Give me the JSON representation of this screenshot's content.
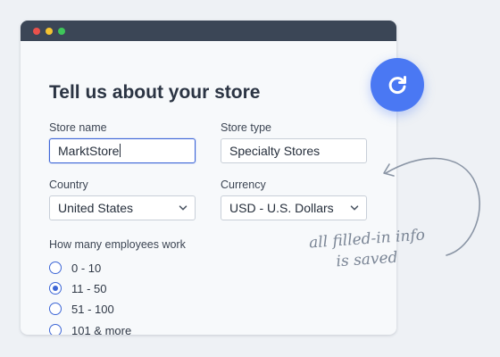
{
  "window": {
    "traffic_lights": [
      "#e9514b",
      "#f3c332",
      "#3ec65a"
    ]
  },
  "form": {
    "title": "Tell us about your store",
    "store_name": {
      "label": "Store name",
      "value": "MarktStore"
    },
    "store_type": {
      "label": "Store type",
      "value": "Specialty Stores"
    },
    "country": {
      "label": "Country",
      "value": "United States"
    },
    "currency": {
      "label": "Currency",
      "value": "USD - U.S. Dollars"
    },
    "employees": {
      "label": "How many employees work",
      "options": [
        "0 - 10",
        "11 - 50",
        "51 - 100",
        "101 & more"
      ],
      "selected": "11 - 50"
    }
  },
  "refresh_button": {
    "icon": "refresh-icon",
    "color": "#4a78f3"
  },
  "annotation": {
    "line1": "all filled-in info",
    "line2": "is saved",
    "color": "#7a8595"
  }
}
